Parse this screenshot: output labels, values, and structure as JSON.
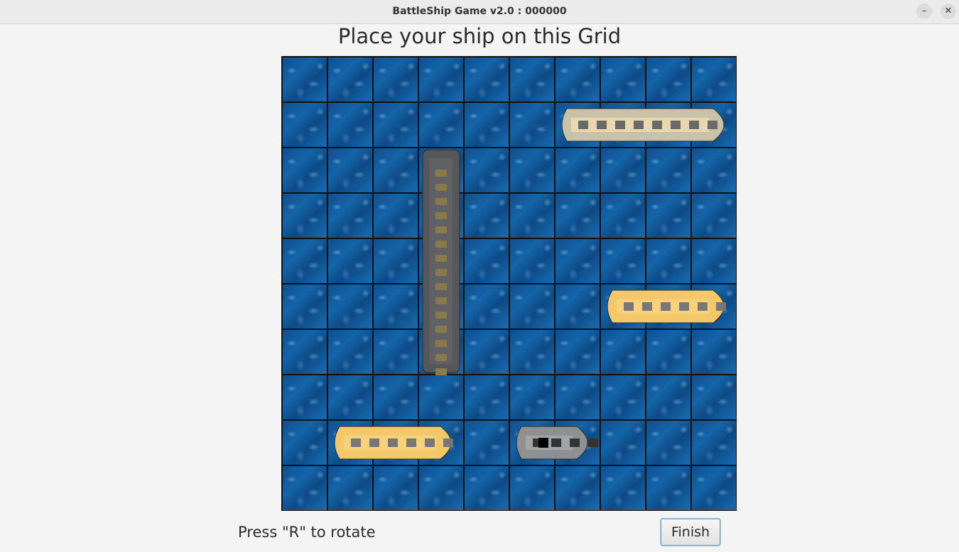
{
  "window": {
    "title": "BattleShip Game v2.0 : 000000",
    "minimize_glyph": "–",
    "close_glyph": "✕"
  },
  "heading": "Place your ship on this Grid",
  "grid": {
    "rows": 10,
    "cols": 10
  },
  "ships": [
    {
      "name": "carrier",
      "row": 2,
      "col": 3,
      "length": 5,
      "orientation": "vertical"
    },
    {
      "name": "battleship",
      "row": 1,
      "col": 6,
      "length": 4,
      "orientation": "horizontal"
    },
    {
      "name": "cruiser",
      "row": 5,
      "col": 7,
      "length": 3,
      "orientation": "horizontal"
    },
    {
      "name": "cruiser-2",
      "row": 8,
      "col": 1,
      "length": 3,
      "orientation": "horizontal"
    },
    {
      "name": "destroyer",
      "row": 8,
      "col": 5,
      "length": 2,
      "orientation": "horizontal"
    }
  ],
  "hint": "Press \"R\" to rotate",
  "finish_label": "Finish"
}
